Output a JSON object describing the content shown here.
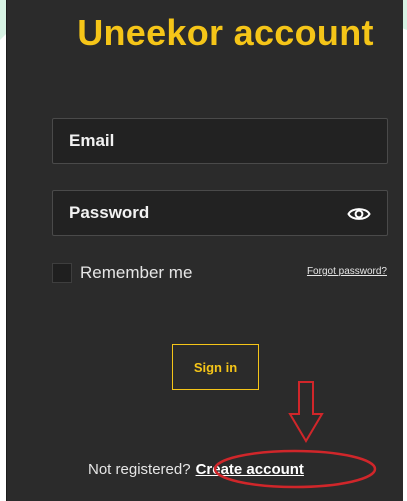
{
  "login": {
    "title": "Uneekor account",
    "email_placeholder": "Email",
    "password_placeholder": "Password",
    "remember_label": "Remember me",
    "forgot_label": "Forgot password?",
    "signin_label": "Sign in",
    "not_registered_text": "Not registered?",
    "create_account_label": "Create account"
  },
  "icons": {
    "password_toggle": "eye-icon",
    "annotation_arrow": "down-arrow-icon",
    "annotation_highlight": "highlight-ellipse"
  },
  "colors": {
    "panel_background": "#2b2b2b",
    "accent": "#f5c518",
    "annotation": "#d0262a",
    "decor_green": "#c3ecd6"
  }
}
